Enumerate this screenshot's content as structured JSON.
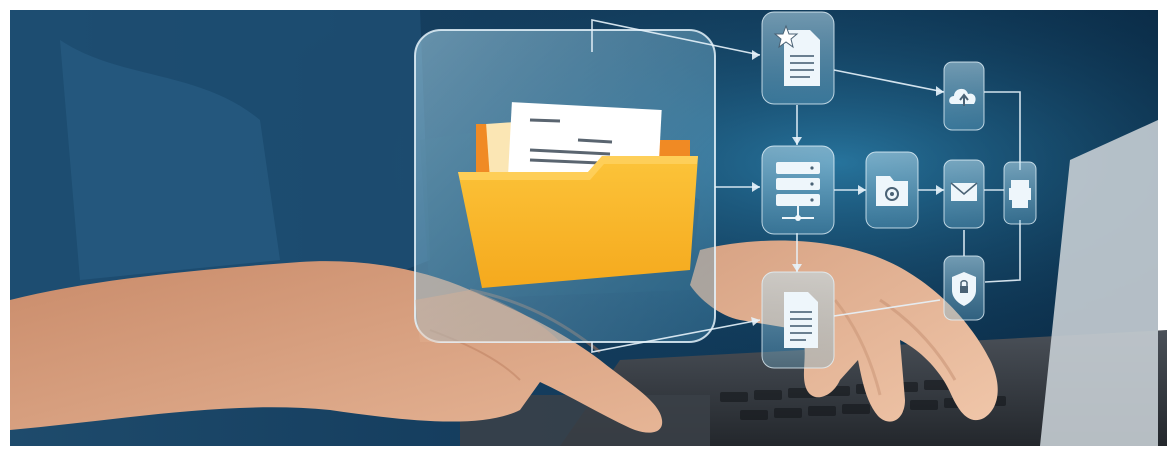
{
  "scene": {
    "subject": "hands-typing-on-laptop",
    "overlay": "document-management-flow",
    "colors": {
      "background_dark": "#0d3a5c",
      "background_mid": "#1a5a80",
      "panel_tint": "#8fc4dd",
      "folder_yellow": "#f9b626",
      "folder_orange": "#f08a24",
      "skin": "#d9a07f",
      "line": "#e7f3fb"
    },
    "icons": [
      "folder-with-documents-icon",
      "starred-document-icon",
      "cloud-upload-icon",
      "server-icon",
      "folder-settings-icon",
      "mail-icon",
      "printer-icon",
      "shield-icon",
      "text-document-icon"
    ]
  }
}
